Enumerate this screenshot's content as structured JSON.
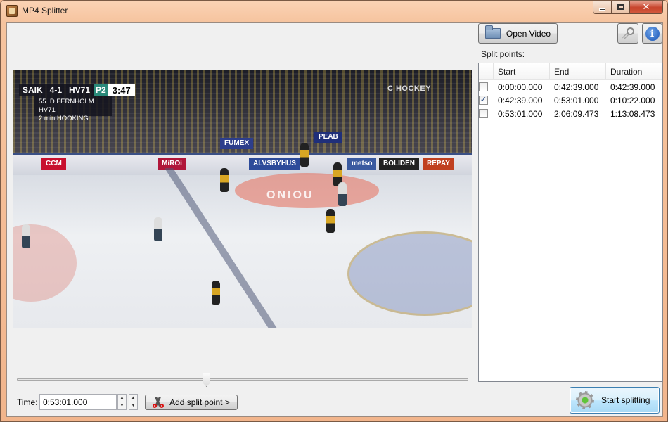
{
  "window": {
    "title": "MP4 Splitter",
    "min_label": "",
    "close_label": "✕"
  },
  "video": {
    "scoreboard": {
      "home": "SAIK",
      "score": "4-1",
      "away": "HV71",
      "period": "P2",
      "clock": "3:47",
      "penalty_line1": "55. D FERNHOLM  HV71",
      "penalty_line2": "2 min   HOOKING"
    },
    "channel_logo": "C HOCKEY",
    "ads": [
      "CCM",
      "MiROi",
      "FUMEX",
      "PEAB",
      "BOLIDEN",
      "REPAY",
      "metso",
      "ALVSBYHUS"
    ],
    "center_text": "ONIOU"
  },
  "slider": {
    "position": 0.42
  },
  "time": {
    "label": "Time:",
    "value": "0:53:01.000"
  },
  "buttons": {
    "add_split": "Add split point >",
    "open_video": "Open Video",
    "start_splitting": "Start splitting",
    "info": "i"
  },
  "split_points": {
    "label": "Split points:",
    "columns": {
      "start": "Start",
      "end": "End",
      "duration": "Duration"
    },
    "rows": [
      {
        "checked": false,
        "start": "0:00:00.000",
        "end": "0:42:39.000",
        "duration": "0:42:39.000"
      },
      {
        "checked": true,
        "start": "0:42:39.000",
        "end": "0:53:01.000",
        "duration": "0:10:22.000"
      },
      {
        "checked": false,
        "start": "0:53:01.000",
        "end": "2:06:09.473",
        "duration": "1:13:08.473"
      }
    ]
  },
  "icons": {
    "app": "app-icon",
    "folder": "folder-icon",
    "wrench": "wrench-icon",
    "info": "info-icon",
    "scissors": "scissors-icon",
    "gear": "gear-icon"
  },
  "colors": {
    "title_bar": "#f6c49f",
    "close_button": "#c7432b",
    "start_button": "#bee6fd"
  }
}
